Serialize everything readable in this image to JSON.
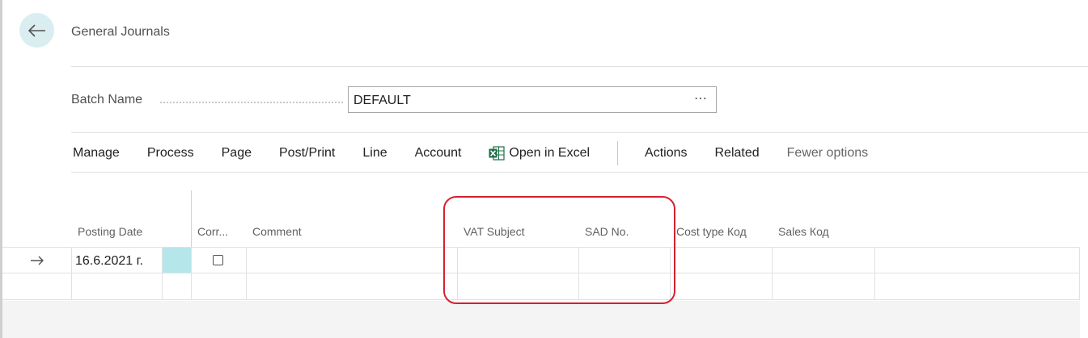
{
  "header": {
    "title": "General Journals",
    "back_icon": "arrow-left-icon"
  },
  "batch": {
    "label": "Batch Name",
    "value": "DEFAULT",
    "lookup": "⋯"
  },
  "actions": {
    "items": [
      "Manage",
      "Process",
      "Page",
      "Post/Print",
      "Line",
      "Account"
    ],
    "open_in_excel": "Open in Excel",
    "actions_label": "Actions",
    "related_label": "Related",
    "fewer_options": "Fewer options"
  },
  "grid": {
    "columns": {
      "posting_date": "Posting Date",
      "correction": "Corr...",
      "comment": "Comment",
      "vat_subject": "VAT Subject",
      "sad_no": "SAD No.",
      "cost_type": "Cost type Код",
      "sales": "Sales Код"
    },
    "rows": [
      {
        "posting_date": "16.6.2021 г.",
        "correction": false,
        "comment": "",
        "vat_subject": "",
        "sad_no": "",
        "cost_type": "",
        "sales": ""
      },
      {
        "posting_date": "",
        "correction": null,
        "comment": "",
        "vat_subject": "",
        "sad_no": "",
        "cost_type": "",
        "sales": ""
      }
    ]
  },
  "colors": {
    "accent": "#daeef2",
    "highlight_cell": "#b4e6ea",
    "annotation": "#d5202f",
    "excel_green": "#1d7044"
  }
}
